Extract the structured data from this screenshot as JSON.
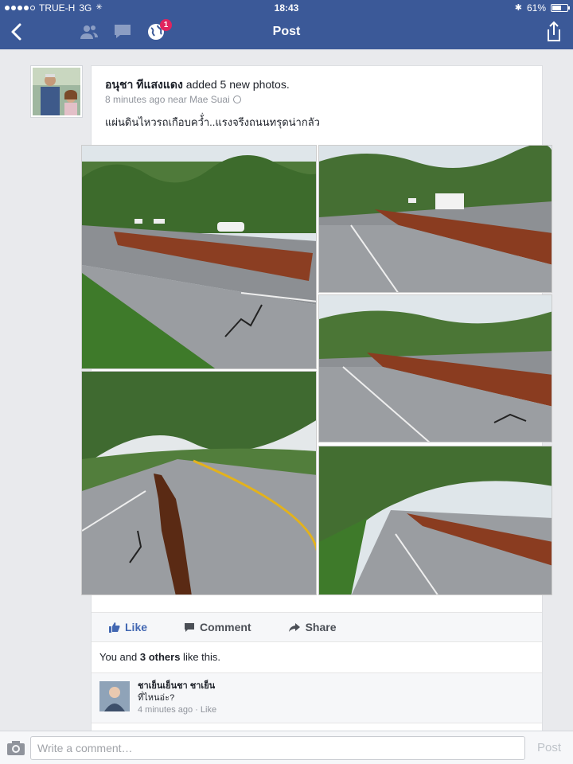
{
  "status_bar": {
    "carrier": "TRUE-H",
    "network": "3G",
    "time": "18:43",
    "battery": "61%",
    "battery_level": 0.61
  },
  "nav": {
    "title": "Post",
    "notification_count": "1"
  },
  "post": {
    "author": "อนุชา ทีแสงแดง",
    "action": " added 5 new photos.",
    "time": "8 minutes ago near Mae Suai",
    "caption": "แผ่นดินไหวรถเกือบคว้่ำ..แรงจรีงถนนทรุดน่ากลัว"
  },
  "actions": {
    "like": "Like",
    "comment": "Comment",
    "share": "Share"
  },
  "likes": {
    "prefix": "You and ",
    "others": "3 others",
    "suffix": " like this."
  },
  "comment": {
    "author": "ชาเย็นเย็นชา ชาเย็น",
    "text": "ที่ไหนอ่ะ?",
    "time": "4 minutes ago",
    "separator": " · ",
    "like": "Like"
  },
  "compose": {
    "placeholder": "Write a comment…",
    "post_label": "Post"
  },
  "colors": {
    "brand": "#3b5998",
    "like_blue": "#4267b2",
    "badge_red": "#e0245e"
  }
}
